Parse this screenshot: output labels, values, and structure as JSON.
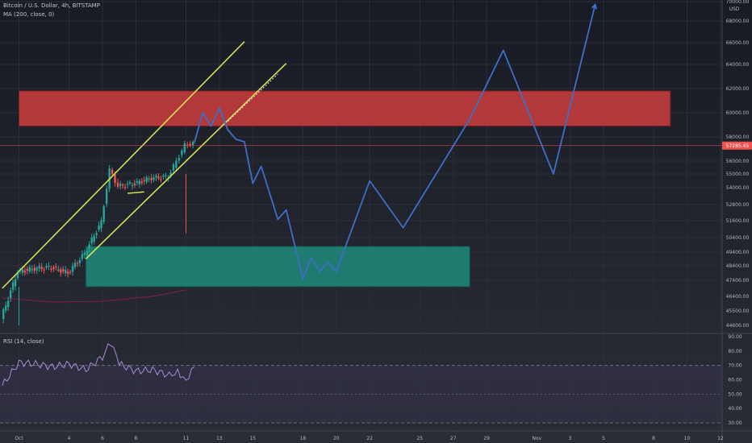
{
  "legend": {
    "symbol": "Bitcoin / U.S. Dollar, 4h, BITSTAMP",
    "ma": "MA (200, close, 0)",
    "rsi": "RSI (14, close)"
  },
  "price_axis": {
    "currency": "USD",
    "labels": [
      "70000.00",
      "68000.00",
      "66000.00",
      "64000.00",
      "62000.00",
      "60000.00",
      "58000.00",
      "56000.00",
      "55000.00",
      "54000.00",
      "52800.00",
      "51600.00",
      "50400.00",
      "49400.00",
      "48400.00",
      "47400.00",
      "46400.00",
      "45500.00",
      "44600.00"
    ],
    "current_price": "57285.45"
  },
  "rsi_axis": {
    "labels": [
      "90.00",
      "80.00",
      "70.00",
      "60.00",
      "50.00",
      "40.00",
      "30.00"
    ],
    "upper_band": 70,
    "lower_band": 30
  },
  "time_axis": {
    "labels": [
      "Oct",
      "4",
      "6",
      "8",
      "11",
      "13",
      "15",
      "18",
      "20",
      "22",
      "25",
      "27",
      "29",
      "Nov",
      "3",
      "5",
      "8",
      "10",
      "12"
    ]
  },
  "colors": {
    "background": "#1c1f2a",
    "up_candle": "#26a69a",
    "down_candle": "#ef5350",
    "channel": "#d4e157",
    "projection": "#3f6ec4",
    "resistance_zone": "#c33b3b",
    "support_zone": "#1e8a7a",
    "rsi_line": "#a78bd9",
    "current_price_tag": "#ef5350"
  },
  "chart_data": {
    "type": "candlestick",
    "title": "Bitcoin / U.S. Dollar, 4h, BITSTAMP",
    "ylim": [
      44600,
      70000
    ],
    "price_line": 57285.45,
    "ma": "MA (200, close, 0)",
    "zones": [
      {
        "kind": "resistance",
        "from_date": "Oct 1",
        "to_date": "Nov 9",
        "low": 58900,
        "high": 61800
      },
      {
        "kind": "support",
        "from_date": "Oct 5",
        "to_date": "Oct 28",
        "low": 47000,
        "high": 49800
      }
    ],
    "price_path": [
      [
        "Sep 30",
        45000
      ],
      [
        "Oct 1",
        48000
      ],
      [
        "Oct 2",
        48200
      ],
      [
        "Oct 3",
        48300
      ],
      [
        "Oct 4",
        47900
      ],
      [
        "Oct 5",
        49300
      ],
      [
        "Oct 6",
        51500
      ],
      [
        "Oct 6.5",
        55300
      ],
      [
        "Oct 7",
        54100
      ],
      [
        "Oct 8",
        54300
      ],
      [
        "Oct 9",
        54700
      ],
      [
        "Oct 10",
        54800
      ],
      [
        "Oct 10.5",
        56000
      ],
      [
        "Oct 11",
        57300
      ],
      [
        "Oct 11.5",
        57500
      ]
    ],
    "projection": [
      [
        "Oct 11.5",
        57500
      ],
      [
        "Oct 12",
        60000
      ],
      [
        "Oct 12.5",
        58900
      ],
      [
        "Oct 13",
        60400
      ],
      [
        "Oct 13.5",
        58600
      ],
      [
        "Oct 14",
        57800
      ],
      [
        "Oct 14.5",
        57600
      ],
      [
        "Oct 15",
        54300
      ],
      [
        "Oct 15.5",
        55600
      ],
      [
        "Oct 16.5",
        51700
      ],
      [
        "Oct 17",
        52400
      ],
      [
        "Oct 18",
        47500
      ],
      [
        "Oct 18.5",
        49000
      ],
      [
        "Oct 19",
        48000
      ],
      [
        "Oct 19.5",
        48700
      ],
      [
        "Oct 20",
        48000
      ],
      [
        "Oct 22",
        54500
      ],
      [
        "Oct 24",
        51100
      ],
      [
        "Oct 28",
        59500
      ],
      [
        "Oct 30",
        65300
      ],
      [
        "Nov 2",
        55000
      ],
      [
        "Nov 4.5",
        69700
      ]
    ],
    "channel_lines": [
      {
        "from": [
          "Sep 30",
          46900
        ],
        "to": [
          "Oct 14.5",
          66100
        ]
      },
      {
        "from": [
          "Oct 5",
          48900
        ],
        "to": [
          "Oct 17",
          64100
        ]
      }
    ],
    "rsi": {
      "label": "RSI (14, close)",
      "ylim": [
        30,
        90
      ],
      "values": [
        [
          "Sep 30",
          56
        ],
        [
          "Oct 1",
          72
        ],
        [
          "Oct 2",
          71
        ],
        [
          "Oct 3",
          69
        ],
        [
          "Oct 4",
          71
        ],
        [
          "Oct 5",
          67
        ],
        [
          "Oct 6",
          76
        ],
        [
          "Oct 6.5",
          86
        ],
        [
          "Oct 7",
          71
        ],
        [
          "Oct 8",
          66
        ],
        [
          "Oct 9",
          67
        ],
        [
          "Oct 10",
          63
        ],
        [
          "Oct 10.5",
          66
        ],
        [
          "Oct 11",
          60
        ],
        [
          "Oct 11.5",
          69
        ]
      ]
    }
  }
}
